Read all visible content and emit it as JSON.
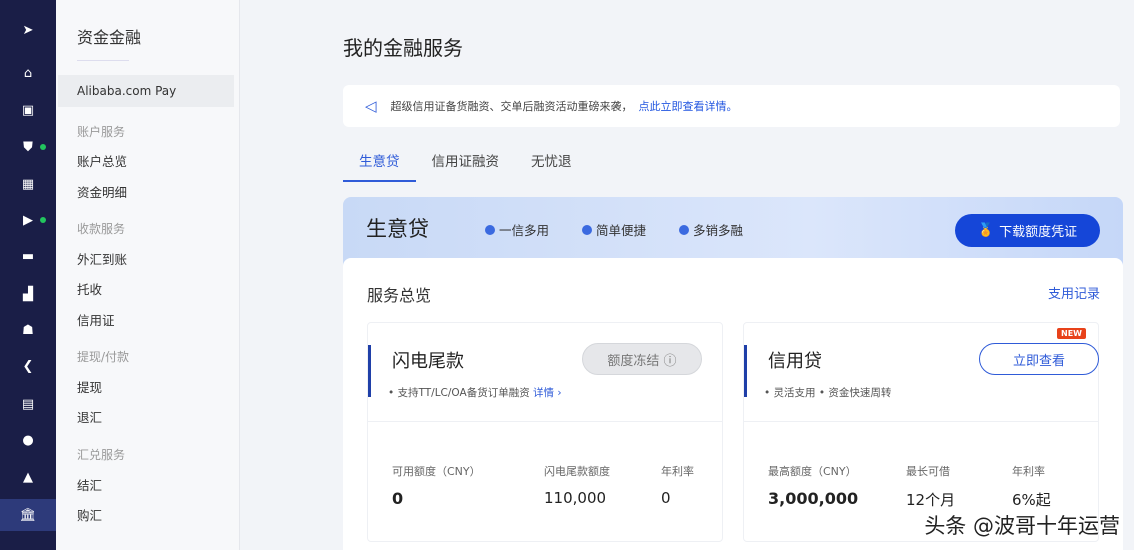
{
  "rail": {
    "icons": [
      "send-icon",
      "home-icon",
      "store-icon",
      "shield-icon",
      "grid-icon",
      "video-icon",
      "message-icon",
      "chart-icon",
      "users-icon",
      "share-icon",
      "clipboard-icon",
      "circle-icon",
      "bell-icon",
      "bank-icon"
    ]
  },
  "sidebar": {
    "title": "资金金融",
    "selected": "Alibaba.com Pay",
    "groups": [
      {
        "label": "账户服务",
        "items": [
          "账户总览",
          "资金明细"
        ]
      },
      {
        "label": "收款服务",
        "items": [
          "外汇到账",
          "托收",
          "信用证"
        ]
      },
      {
        "label": "提现/付款",
        "items": [
          "提现",
          "退汇"
        ]
      },
      {
        "label": "汇兑服务",
        "items": [
          "结汇",
          "购汇"
        ]
      }
    ]
  },
  "main": {
    "title": "我的金融服务",
    "notice": {
      "text": "超级信用证备货融资、交单后融资活动重磅来袭，",
      "link": "点此立即查看详情。"
    },
    "tabs": [
      "生意贷",
      "信用证融资",
      "无忧退"
    ],
    "banner": {
      "title": "生意贷",
      "features": [
        "一信多用",
        "简单便捷",
        "多销多融"
      ],
      "download": "下载额度凭证"
    },
    "overview": {
      "title": "服务总览",
      "record_link": "支用记录"
    },
    "products": [
      {
        "name": "闪电尾款",
        "button": "额度冻结 ⓘ",
        "desc": "支持TT/LC/OA备货订单融资",
        "desc_link": "详情 ›",
        "stats": [
          {
            "label": "可用额度（CNY）",
            "value": "0"
          },
          {
            "label": "闪电尾款额度",
            "value": "110,000"
          },
          {
            "label": "年利率",
            "value": "0"
          }
        ]
      },
      {
        "name": "信用贷",
        "button": "立即查看",
        "badge": "NEW",
        "desc": "• 灵活支用 • 资金快速周转",
        "stats": [
          {
            "label": "最高额度（CNY）",
            "value": "3,000,000"
          },
          {
            "label": "最长可借",
            "value": "12个月"
          },
          {
            "label": "年利率",
            "value": "6%起"
          }
        ]
      }
    ]
  },
  "watermark": "头条 @波哥十年运营"
}
